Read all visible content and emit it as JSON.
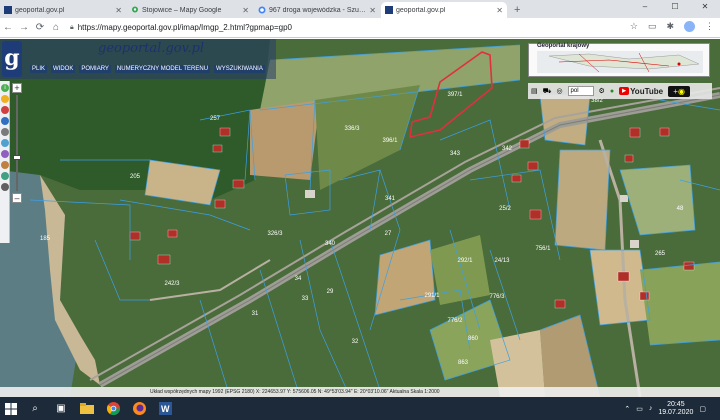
{
  "tabs": [
    {
      "title": "geoportal.gov.pl",
      "active": false
    },
    {
      "title": "Stojowice – Mapy Google",
      "active": false
    },
    {
      "title": "967 droga wojewódzka - Szukaj",
      "active": false
    },
    {
      "title": "geoportal.gov.pl",
      "active": true
    }
  ],
  "address": {
    "url": "https://mapy.geoportal.gov.pl/imap/Imgp_2.html?gpmap=gp0"
  },
  "geoportal": {
    "name": "geoportal.gov.pl",
    "menu": [
      "PLIK",
      "WIDOK",
      "POMIARY",
      "NUMERYCZNY MODEL TERENU",
      "WYSZUKIWANIA"
    ]
  },
  "overview": {
    "title": "Geoportal krajowy"
  },
  "toolbar": {
    "language": "pol",
    "youtube": "YouTube"
  },
  "parcels": [
    {
      "label": "397/1"
    },
    {
      "label": "396/1"
    },
    {
      "label": "336/3"
    },
    {
      "label": "257"
    },
    {
      "label": "205"
    },
    {
      "label": "343"
    },
    {
      "label": "342"
    },
    {
      "label": "341"
    },
    {
      "label": "340"
    },
    {
      "label": "326/3"
    },
    {
      "label": "27"
    },
    {
      "label": "25/2"
    },
    {
      "label": "24/13"
    },
    {
      "label": "756/1"
    },
    {
      "label": "776/3"
    },
    {
      "label": "776/2"
    },
    {
      "label": "34"
    },
    {
      "label": "33"
    },
    {
      "label": "29"
    },
    {
      "label": "31"
    },
    {
      "label": "32"
    },
    {
      "label": "860"
    },
    {
      "label": "863"
    },
    {
      "label": "242/3"
    },
    {
      "label": "185"
    },
    {
      "label": "38/2"
    },
    {
      "label": "48"
    },
    {
      "label": "265"
    },
    {
      "label": "291/1"
    },
    {
      "label": "292/1"
    }
  ],
  "status": {
    "text": "Układ współrzędnych mapy 1992 (EPSG 2180)   X: 224653.97  Y: 575606.05   N: 49°53'03.94\"  E: 20°03'10.06\"   Aktualna Skala 1:2000"
  },
  "taskbar": {
    "time": "20:45",
    "date": "19.07.2020"
  },
  "colors": {
    "parcel_lines": "#3ca0e6",
    "highlight": "#e03040",
    "taskbar": "#1c2a3a"
  }
}
